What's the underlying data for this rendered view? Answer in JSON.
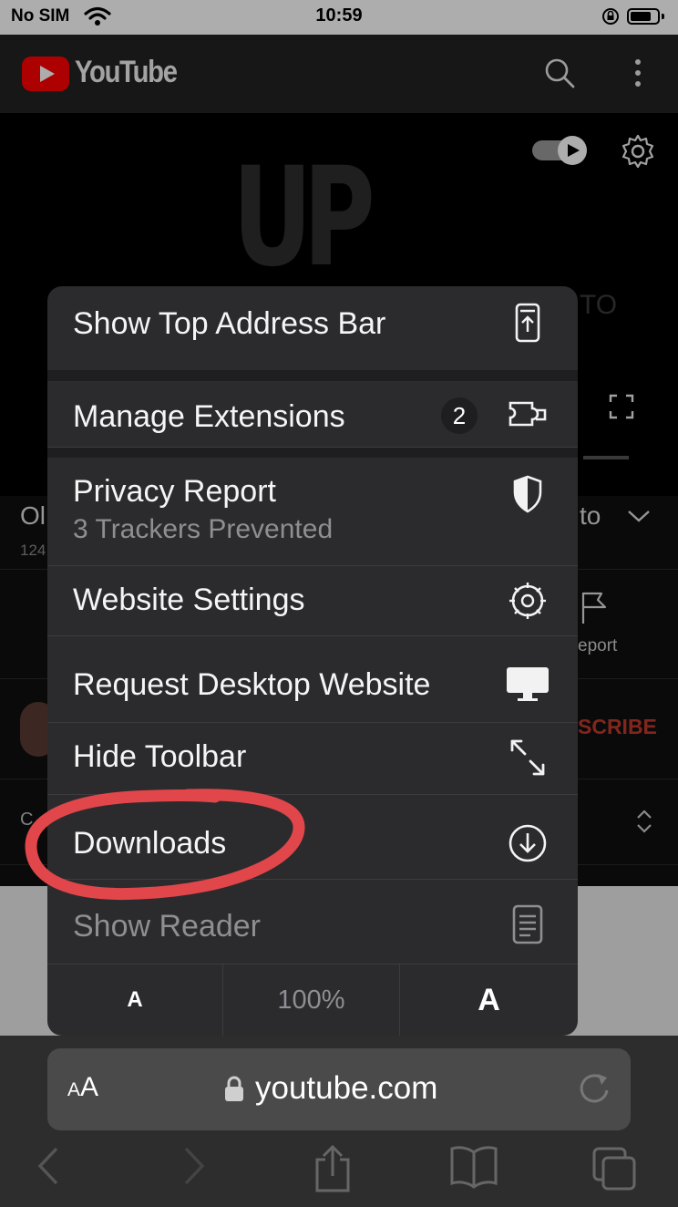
{
  "status_bar": {
    "carrier": "No SIM",
    "time": "10:59"
  },
  "header": {
    "brand": "YouTube"
  },
  "video": {
    "overlay_text": "UP",
    "side_text": "TO"
  },
  "page": {
    "title_fragment": "Ol",
    "meta_fragment": "124",
    "title_right_fragment": "to",
    "report_label": "eport",
    "subscribe_label": "SCRIBE",
    "comments_fragment": "C"
  },
  "menu": {
    "items": [
      {
        "label": "Show Top Address Bar",
        "icon": "show-top-address-bar-icon"
      },
      {
        "label": "Manage Extensions",
        "badge": "2",
        "icon": "extension-icon"
      },
      {
        "label": "Privacy Report",
        "subtitle": "3 Trackers Prevented",
        "icon": "shield-icon"
      },
      {
        "label": "Website Settings",
        "icon": "gear-icon"
      },
      {
        "label": "Request Desktop Website",
        "icon": "desktop-icon"
      },
      {
        "label": "Hide Toolbar",
        "icon": "resize-arrows-icon"
      },
      {
        "label": "Downloads",
        "icon": "download-circle-icon"
      },
      {
        "label": "Show Reader",
        "icon": "reader-icon",
        "disabled": true
      }
    ],
    "zoom": {
      "decrease_label": "A",
      "level": "100%",
      "increase_label": "A"
    }
  },
  "address_bar": {
    "text_size_label": "AA",
    "url": "youtube.com"
  },
  "colors": {
    "annotation_circle": "#e0464a",
    "youtube_red": "#ff0000",
    "subscribe_red": "#c0392b"
  }
}
